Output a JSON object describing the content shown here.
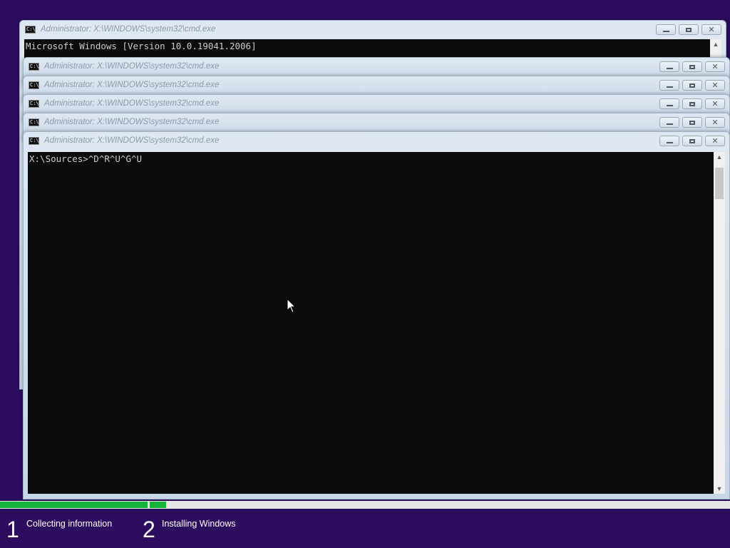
{
  "cmd_window_title": "Administrator: X:\\WINDOWS\\system32\\cmd.exe",
  "cmd_icon_text": "C:\\",
  "back_window_console": "Microsoft Windows [Version 10.0.19041.2006]",
  "front_window_console": "X:\\Sources>^D^R^U^G^U",
  "setup_steps": [
    {
      "number": "1",
      "label": "Collecting information"
    },
    {
      "number": "2",
      "label": "Installing Windows"
    }
  ],
  "progress_state": {
    "step1_complete": 1.0,
    "step2_progress": 0.03
  },
  "colors": {
    "desktop_background": "#2d0d5e",
    "progress_green": "#16b33b",
    "console_background": "#0c0c0c"
  }
}
